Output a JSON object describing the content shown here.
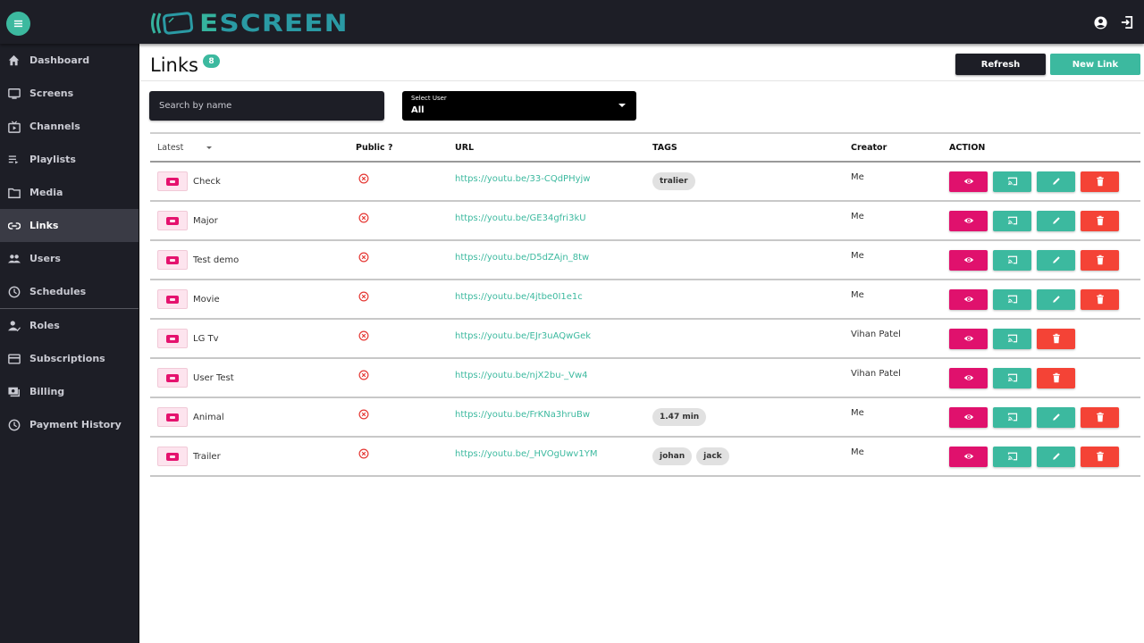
{
  "app": {
    "logo_prefix": "E",
    "logo_rest": "SCREEN",
    "brand_color": "#3cb99f",
    "dark_color": "#1d1e26",
    "view_color": "#e0116d",
    "delete_color": "#f44336"
  },
  "topbar": {
    "menu_icon": "menu-icon",
    "account_icon": "account-circle-icon",
    "logout_icon": "logout-icon"
  },
  "sidebar": {
    "items": [
      {
        "label": "Dashboard",
        "icon": "home-icon"
      },
      {
        "label": "Screens",
        "icon": "monitor-icon"
      },
      {
        "label": "Channels",
        "icon": "tv-play-icon"
      },
      {
        "label": "Playlists",
        "icon": "playlist-icon"
      },
      {
        "label": "Media",
        "icon": "folder-icon"
      },
      {
        "label": "Links",
        "icon": "link-icon",
        "active": true
      },
      {
        "label": "Users",
        "icon": "users-icon"
      },
      {
        "label": "Schedules",
        "icon": "clock-icon"
      },
      {
        "label": "Roles",
        "icon": "user-check-icon"
      },
      {
        "label": "Subscriptions",
        "icon": "card-icon"
      },
      {
        "label": "Billing",
        "icon": "money-icon"
      },
      {
        "label": "Payment History",
        "icon": "history-icon"
      }
    ]
  },
  "page": {
    "title": "Links",
    "count": "8",
    "refresh_label": "Refresh",
    "new_label": "New Link"
  },
  "filters": {
    "search_placeholder": "Search by name",
    "select_label": "Select User",
    "select_value": "All"
  },
  "table": {
    "headers": {
      "sort": "Latest",
      "public": "Public ?",
      "url": "URL",
      "tags": "TAGS",
      "creator": "Creator",
      "action": "ACTION"
    },
    "rows": [
      {
        "name": "Check",
        "public": false,
        "url": "https://youtu.be/33-CQdPHyjw",
        "tags": [
          "tralier"
        ],
        "creator": "Me",
        "editable": true
      },
      {
        "name": "Major",
        "public": false,
        "url": "https://youtu.be/GE34gfri3kU",
        "tags": [],
        "creator": "Me",
        "editable": true
      },
      {
        "name": "Test demo",
        "public": false,
        "url": "https://youtu.be/D5dZAjn_8tw",
        "tags": [],
        "creator": "Me",
        "editable": true
      },
      {
        "name": "Movie",
        "public": false,
        "url": "https://youtu.be/4jtbe0I1e1c",
        "tags": [],
        "creator": "Me",
        "editable": true
      },
      {
        "name": "LG Tv",
        "public": false,
        "url": "https://youtu.be/EJr3uAQwGek",
        "tags": [],
        "creator": "Vihan Patel",
        "editable": false
      },
      {
        "name": "User Test",
        "public": false,
        "url": "https://youtu.be/njX2bu-_Vw4",
        "tags": [],
        "creator": "Vihan Patel",
        "editable": false
      },
      {
        "name": "Animal",
        "public": false,
        "url": "https://youtu.be/FrKNa3hruBw",
        "tags": [
          "1.47 min"
        ],
        "creator": "Me",
        "editable": true
      },
      {
        "name": "Trailer",
        "public": false,
        "url": "https://youtu.be/_HVOgUwv1YM",
        "tags": [
          "johan",
          "jack"
        ],
        "creator": "Me",
        "editable": true
      }
    ]
  }
}
